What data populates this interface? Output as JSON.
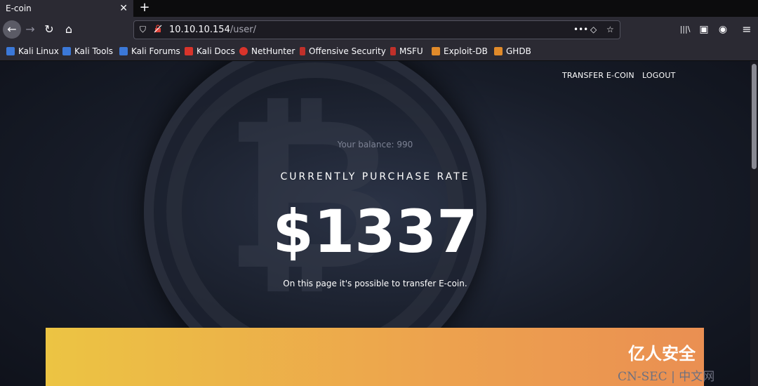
{
  "browser": {
    "tab_title": "E-coin",
    "tab_close": "✕",
    "new_tab": "+",
    "url_host": "10.10.10.154",
    "url_path": "/user/",
    "icons": {
      "back": "←",
      "forward": "→",
      "reload": "↻",
      "home": "⌂",
      "shield": "⛉",
      "insecure": "🔓",
      "more": "•••",
      "pocket": "◇",
      "star": "☆",
      "library": "|||\\",
      "sidebar": "▣",
      "account": "◉",
      "menu": "≡"
    },
    "bookmarks": [
      {
        "label": "Kali Linux",
        "color": "#3b78d8"
      },
      {
        "label": "Kali Tools",
        "color": "#3b78d8"
      },
      {
        "label": "Kali Forums",
        "color": "#3b78d8"
      },
      {
        "label": "Kali Docs",
        "color": "#d9342b"
      },
      {
        "label": "NetHunter",
        "color": "#d9342b"
      },
      {
        "label": "Offensive Security",
        "color": "#c0302a"
      },
      {
        "label": "MSFU",
        "color": "#c0302a"
      },
      {
        "label": "Exploit-DB",
        "color": "#e08a2a"
      },
      {
        "label": "GHDB",
        "color": "#e08a2a"
      }
    ]
  },
  "page": {
    "nav_transfer": "TRANSFER E-COIN",
    "nav_logout": "LOGOUT",
    "balance": "Your balance: 990",
    "rate_label": "CURRENTLY PURCHASE RATE",
    "rate_value": "$1337",
    "description": "On this page it's possible to transfer E-coin."
  },
  "watermark": {
    "line1": "亿人安全",
    "line2": "CN-SEC | 中文网"
  }
}
